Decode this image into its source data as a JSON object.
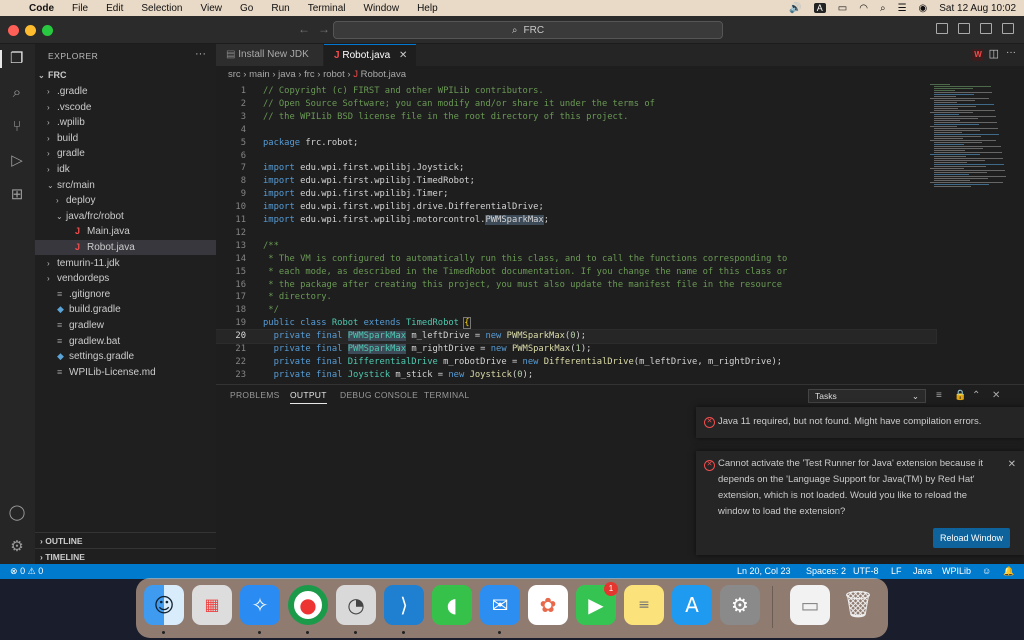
{
  "menubar": {
    "apple": "",
    "app": "Code",
    "items": [
      "File",
      "Edit",
      "Selection",
      "View",
      "Go",
      "Run",
      "Terminal",
      "Window",
      "Help"
    ],
    "input_indicator": "A",
    "datetime": "Sat 12 Aug  10:02"
  },
  "titlebar": {
    "command_center": "FRC"
  },
  "sidebar": {
    "header": "EXPLORER",
    "root": "FRC",
    "tree": [
      {
        "label": ".gradle",
        "kind": "folder",
        "open": false
      },
      {
        "label": ".vscode",
        "kind": "folder",
        "open": false
      },
      {
        "label": ".wpilib",
        "kind": "folder",
        "open": false
      },
      {
        "label": "build",
        "kind": "folder",
        "open": false
      },
      {
        "label": "gradle",
        "kind": "folder",
        "open": false
      },
      {
        "label": "idk",
        "kind": "folder",
        "open": false
      },
      {
        "label": "src/main",
        "kind": "folder",
        "open": true
      },
      {
        "label": "deploy",
        "kind": "folder",
        "open": false
      },
      {
        "label": "java/frc/robot",
        "kind": "folder",
        "open": true
      },
      {
        "label": "Main.java",
        "kind": "java"
      },
      {
        "label": "Robot.java",
        "kind": "java"
      },
      {
        "label": "temurin-11.jdk",
        "kind": "folder",
        "open": false
      },
      {
        "label": "vendordeps",
        "kind": "folder",
        "open": false
      },
      {
        "label": ".gitignore",
        "kind": "file"
      },
      {
        "label": "build.gradle",
        "kind": "gradle"
      },
      {
        "label": "gradlew",
        "kind": "file"
      },
      {
        "label": "gradlew.bat",
        "kind": "file"
      },
      {
        "label": "settings.gradle",
        "kind": "gradle"
      },
      {
        "label": "WPILib-License.md",
        "kind": "file"
      }
    ],
    "outline": "OUTLINE",
    "timeline": "TIMELINE"
  },
  "tabs": [
    {
      "label": "Install New JDK",
      "active": false
    },
    {
      "label": "Robot.java",
      "active": true
    }
  ],
  "breadcrumb": [
    "src",
    "main",
    "java",
    "frc",
    "robot",
    "Robot.java"
  ],
  "code": [
    {
      "n": "1",
      "t": "// Copyright (c) FIRST and other WPILib contributors."
    },
    {
      "n": "2",
      "t": "// Open Source Software; you can modify and/or share it under the terms of"
    },
    {
      "n": "3",
      "t": "// the WPILib BSD license file in the root directory of this project."
    },
    {
      "n": "4",
      "t": ""
    },
    {
      "n": "5",
      "t": "package frc.robot;"
    },
    {
      "n": "6",
      "t": ""
    },
    {
      "n": "7",
      "t": "import edu.wpi.first.wpilibj.Joystick;"
    },
    {
      "n": "8",
      "t": "import edu.wpi.first.wpilibj.TimedRobot;"
    },
    {
      "n": "9",
      "t": "import edu.wpi.first.wpilibj.Timer;"
    },
    {
      "n": "10",
      "t": "import edu.wpi.first.wpilibj.drive.DifferentialDrive;"
    },
    {
      "n": "11",
      "t": "import edu.wpi.first.wpilibj.motorcontrol.PWMSparkMax;"
    },
    {
      "n": "12",
      "t": ""
    },
    {
      "n": "13",
      "t": "/**"
    },
    {
      "n": "14",
      "t": " * The VM is configured to automatically run this class, and to call the functions corresponding to"
    },
    {
      "n": "15",
      "t": " * each mode, as described in the TimedRobot documentation. If you change the name of this class or"
    },
    {
      "n": "16",
      "t": " * the package after creating this project, you must also update the manifest file in the resource"
    },
    {
      "n": "17",
      "t": " * directory."
    },
    {
      "n": "18",
      "t": " */"
    },
    {
      "n": "19",
      "t": "public class Robot extends TimedRobot {"
    },
    {
      "n": "20",
      "t": "  private final PWMSparkMax m_leftDrive = new PWMSparkMax(0);"
    },
    {
      "n": "21",
      "t": "  private final PWMSparkMax m_rightDrive = new PWMSparkMax(1);"
    },
    {
      "n": "22",
      "t": "  private final DifferentialDrive m_robotDrive = new DifferentialDrive(m_leftDrive, m_rightDrive);"
    },
    {
      "n": "23",
      "t": "  private final Joystick m_stick = new Joystick(0);"
    }
  ],
  "panel": {
    "tabs": [
      "PROBLEMS",
      "OUTPUT",
      "DEBUG CONSOLE",
      "TERMINAL"
    ],
    "active_tab": "OUTPUT",
    "select_value": "Tasks"
  },
  "notifications": {
    "first": "Java 11 required, but not found. Might have compilation errors.",
    "second": "Cannot activate the 'Test Runner for Java' extension because it depends on the 'Language Support for Java(TM) by Red Hat' extension, which is not loaded. Would you like to reload the window to load the extension?",
    "reload_button": "Reload Window"
  },
  "statusbar": {
    "errors": "0",
    "warnings": "0",
    "position": "Ln 20, Col 23",
    "spaces": "Spaces: 2",
    "encoding": "UTF-8",
    "eol": "LF",
    "language": "Java",
    "wpilib": "WPILib"
  },
  "dock": {
    "items": [
      "Finder",
      "Launchpad",
      "Safari",
      "Chrome",
      "Instruments",
      "VS Code",
      "Messages",
      "Mail",
      "Photos",
      "FaceTime",
      "Notes",
      "App Store",
      "System Settings",
      "Preview",
      "Trash"
    ],
    "facetime_badge": "1"
  },
  "colors": {
    "accent": "#007acc",
    "button": "#0e639c",
    "error": "#f14c4c",
    "comment": "#6a9955",
    "keyword": "#569cd6",
    "type": "#4ec9b0"
  }
}
